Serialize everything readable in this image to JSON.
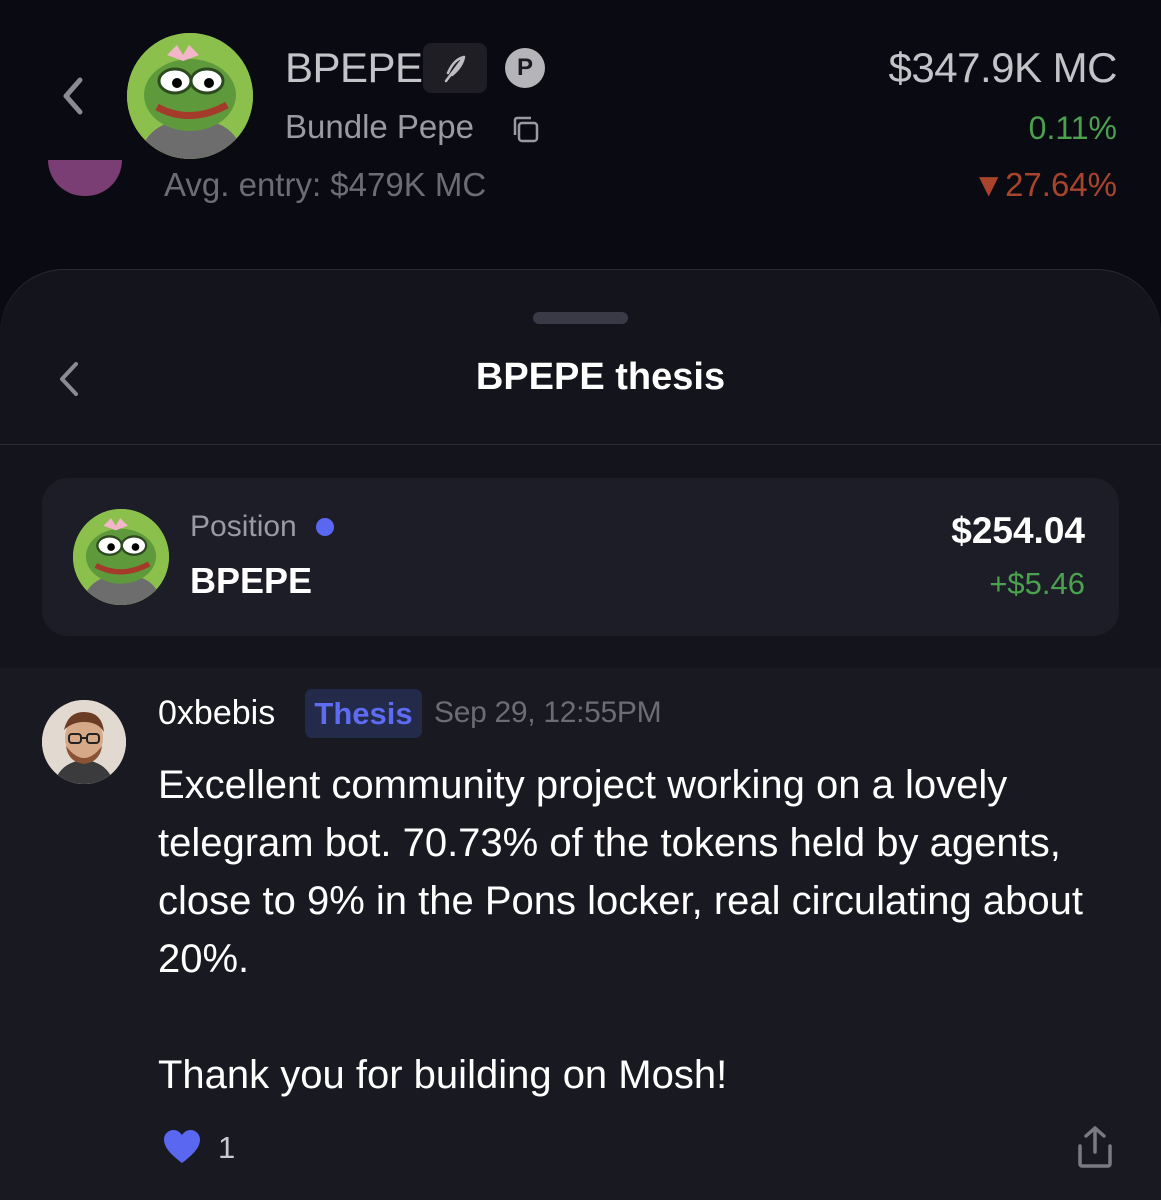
{
  "header": {
    "token_ticker": "BPEPE",
    "token_name": "Bundle Pepe",
    "market_cap": "$347.9K MC",
    "market_cap_change": "0.11%",
    "avg_entry": "Avg. entry: $479K MC",
    "pnl_percent": "▼27.64%",
    "badge_letter": "P"
  },
  "sheet": {
    "title": "BPEPE thesis"
  },
  "position": {
    "label": "Position",
    "ticker": "BPEPE",
    "value": "$254.04",
    "change": "+$5.46"
  },
  "comment": {
    "username": "0xbebis",
    "badge": "Thesis",
    "timestamp": "Sep 29, 12:55PM",
    "body_line_1": "Excellent community project working on a lovely telegram bot. 70.73% of the tokens held by agents, close to 9% in the Pons locker, real circulating about 20%.",
    "body_line_2": "Thank you for building on Mosh!",
    "like_count": "1"
  },
  "colors": {
    "accent": "#5a67f0",
    "positive": "#4aa24e",
    "negative": "#a8432c",
    "sheet_bg": "#14141d"
  },
  "icons": [
    "back-chevron-icon",
    "quill-icon",
    "copy-icon",
    "heart-icon",
    "share-icon"
  ]
}
